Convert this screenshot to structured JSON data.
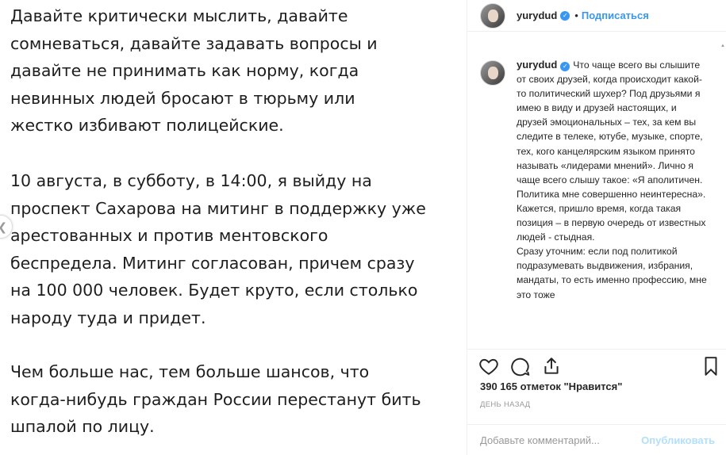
{
  "post_image": {
    "paragraph1": "Давайте критически мыслить, давайте\nсомневаться, давайте задавать вопросы и\nдавайте не принимать как норму, когда\nневинных людей бросают в тюрьму или\nжестко избивают полицейские.",
    "paragraph2": "10 августа, в субботу, в 14:00, я выйду на\nпроспект Сахарова на митинг в поддержку уже\nарестованных и против ментовского\nбеспредела. Митинг согласован, причем сразу\nна 100 000 человек. Будет круто, если столько\nнароду туда и придет.",
    "paragraph3": "Чем больше нас, тем больше шансов, что\nкогда-нибудь граждан России перестанут бить\nшпалой по лицу."
  },
  "header": {
    "username": "yurydud",
    "separator": "•",
    "follow_label": "Подписаться"
  },
  "caption": {
    "username": "yurydud",
    "text": "Что чаще всего вы слышите от своих друзей, когда происходит какой-то политический шухер? Под друзьями я имею в виду и друзей настоящих, и друзей эмоциональных – тех, за кем вы следите в телеке, ютубе, музыке, спорте, тех, кого канцелярским языком принято называть «лидерами мнений». Лично я чаще всего слышу такое: «Я аполитичен. Политика мне совершенно неинтересна». Кажется, пришло время, когда такая позиция – в первую очередь от известных людей - стыдная.",
    "text2": "Сразу уточним: если под политикой подразумевать выдвижения, избрания, мандаты, то есть именно профессию, мне это тоже"
  },
  "likes": "390 165 отметок \"Нравится\"",
  "time_ago": "ДЕНЬ НАЗАД",
  "comment": {
    "placeholder": "Добавьте комментарий...",
    "publish_label": "Опубликовать"
  },
  "icons": {
    "heart": "heart-icon",
    "comment": "comment-icon",
    "share": "share-icon",
    "bookmark": "bookmark-icon",
    "verified": "verified-badge-icon"
  },
  "colors": {
    "accent": "#3897f0",
    "publish_disabled": "#b2dffc",
    "muted": "#999999"
  }
}
